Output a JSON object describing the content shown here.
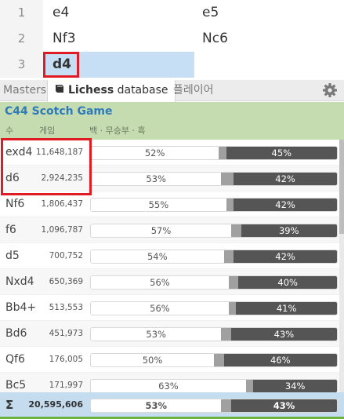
{
  "moves": [
    {
      "num": "1",
      "white": "e4",
      "black": "e5"
    },
    {
      "num": "2",
      "white": "Nf3",
      "black": "Nc6"
    },
    {
      "num": "3",
      "white": "d4",
      "black": ""
    }
  ],
  "tabs": {
    "masters": "Masters",
    "lichess_strong": "Lichess",
    "lichess_rest": " database",
    "player": "플레이어"
  },
  "opening": {
    "name": "C44 Scotch Game",
    "header_move": "수",
    "header_games": "게임",
    "header_wdb": "백 · 무승부 · 흑"
  },
  "rows": [
    {
      "move": "exd4",
      "games": "11,648,187",
      "white": 52,
      "draw": 3,
      "black": 45,
      "white_label": "52%",
      "draw_label": "",
      "black_label": "45%"
    },
    {
      "move": "d6",
      "games": "2,924,235",
      "white": 53,
      "draw": 5,
      "black": 42,
      "white_label": "53%",
      "draw_label": "",
      "black_label": "42%"
    },
    {
      "move": "Nf6",
      "games": "1,806,437",
      "white": 55,
      "draw": 3,
      "black": 42,
      "white_label": "55%",
      "draw_label": "",
      "black_label": "42%"
    },
    {
      "move": "f6",
      "games": "1,096,787",
      "white": 57,
      "draw": 4,
      "black": 39,
      "white_label": "57%",
      "draw_label": "",
      "black_label": "39%"
    },
    {
      "move": "d5",
      "games": "700,752",
      "white": 54,
      "draw": 4,
      "black": 42,
      "white_label": "54%",
      "draw_label": "",
      "black_label": "42%"
    },
    {
      "move": "Nxd4",
      "games": "650,369",
      "white": 56,
      "draw": 4,
      "black": 40,
      "white_label": "56%",
      "draw_label": "",
      "black_label": "40%"
    },
    {
      "move": "Bb4+",
      "games": "513,553",
      "white": 56,
      "draw": 3,
      "black": 41,
      "white_label": "56%",
      "draw_label": "",
      "black_label": "41%"
    },
    {
      "move": "Bd6",
      "games": "451,973",
      "white": 53,
      "draw": 4,
      "black": 43,
      "white_label": "53%",
      "draw_label": "",
      "black_label": "43%"
    },
    {
      "move": "Qf6",
      "games": "176,005",
      "white": 50,
      "draw": 4,
      "black": 46,
      "white_label": "50%",
      "draw_label": "",
      "black_label": "46%"
    },
    {
      "move": "Bc5",
      "games": "171,997",
      "white": 63,
      "draw": 3,
      "black": 34,
      "white_label": "63%",
      "draw_label": "",
      "black_label": "34%"
    }
  ],
  "total": {
    "symbol": "Σ",
    "games": "20,595,606",
    "white": 53,
    "draw": 4,
    "black": 43,
    "white_label": "53%",
    "black_label": "43%"
  },
  "colors": {
    "highlight": "#e01b24",
    "active_move": "#c6dff4",
    "opening_bg": "#c4dcb0",
    "opening_text": "#2f7ab8",
    "total_bg": "#c5dcef"
  },
  "icons": {
    "book": "book-icon",
    "settings": "gear-icon"
  }
}
